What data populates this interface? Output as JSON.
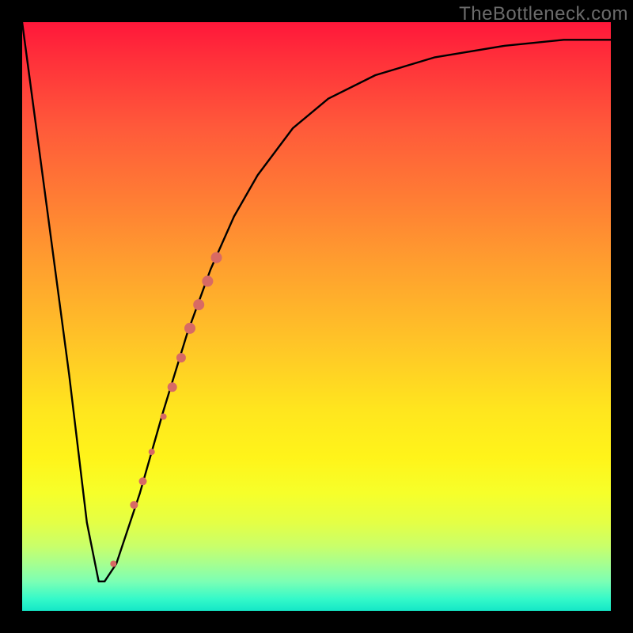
{
  "watermark": "TheBottleneck.com",
  "colors": {
    "frame": "#000000",
    "curve": "#000000",
    "marker": "#d86a64",
    "gradient_top": "#ff173a",
    "gradient_bottom": "#14e7c7"
  },
  "chart_data": {
    "type": "line",
    "title": "",
    "xlabel": "",
    "ylabel": "",
    "xlim": [
      0,
      100
    ],
    "ylim": [
      0,
      100
    ],
    "grid": false,
    "legend": false,
    "series": [
      {
        "name": "bottleneck-curve",
        "x": [
          0,
          4,
          8,
          11,
          13,
          14,
          16,
          20,
          24,
          28,
          32,
          36,
          40,
          46,
          52,
          60,
          70,
          82,
          92,
          100
        ],
        "values": [
          100,
          70,
          40,
          15,
          5,
          5,
          8,
          20,
          34,
          47,
          58,
          67,
          74,
          82,
          87,
          91,
          94,
          96,
          97,
          97
        ]
      }
    ],
    "markers": [
      {
        "x": 15.5,
        "y": 8,
        "r": 4
      },
      {
        "x": 19,
        "y": 18,
        "r": 5
      },
      {
        "x": 20.5,
        "y": 22,
        "r": 5
      },
      {
        "x": 22,
        "y": 27,
        "r": 4
      },
      {
        "x": 24,
        "y": 33,
        "r": 4
      },
      {
        "x": 25.5,
        "y": 38,
        "r": 6
      },
      {
        "x": 27,
        "y": 43,
        "r": 6
      },
      {
        "x": 28.5,
        "y": 48,
        "r": 7
      },
      {
        "x": 30,
        "y": 52,
        "r": 7
      },
      {
        "x": 31.5,
        "y": 56,
        "r": 7
      },
      {
        "x": 33,
        "y": 60,
        "r": 7
      }
    ]
  }
}
